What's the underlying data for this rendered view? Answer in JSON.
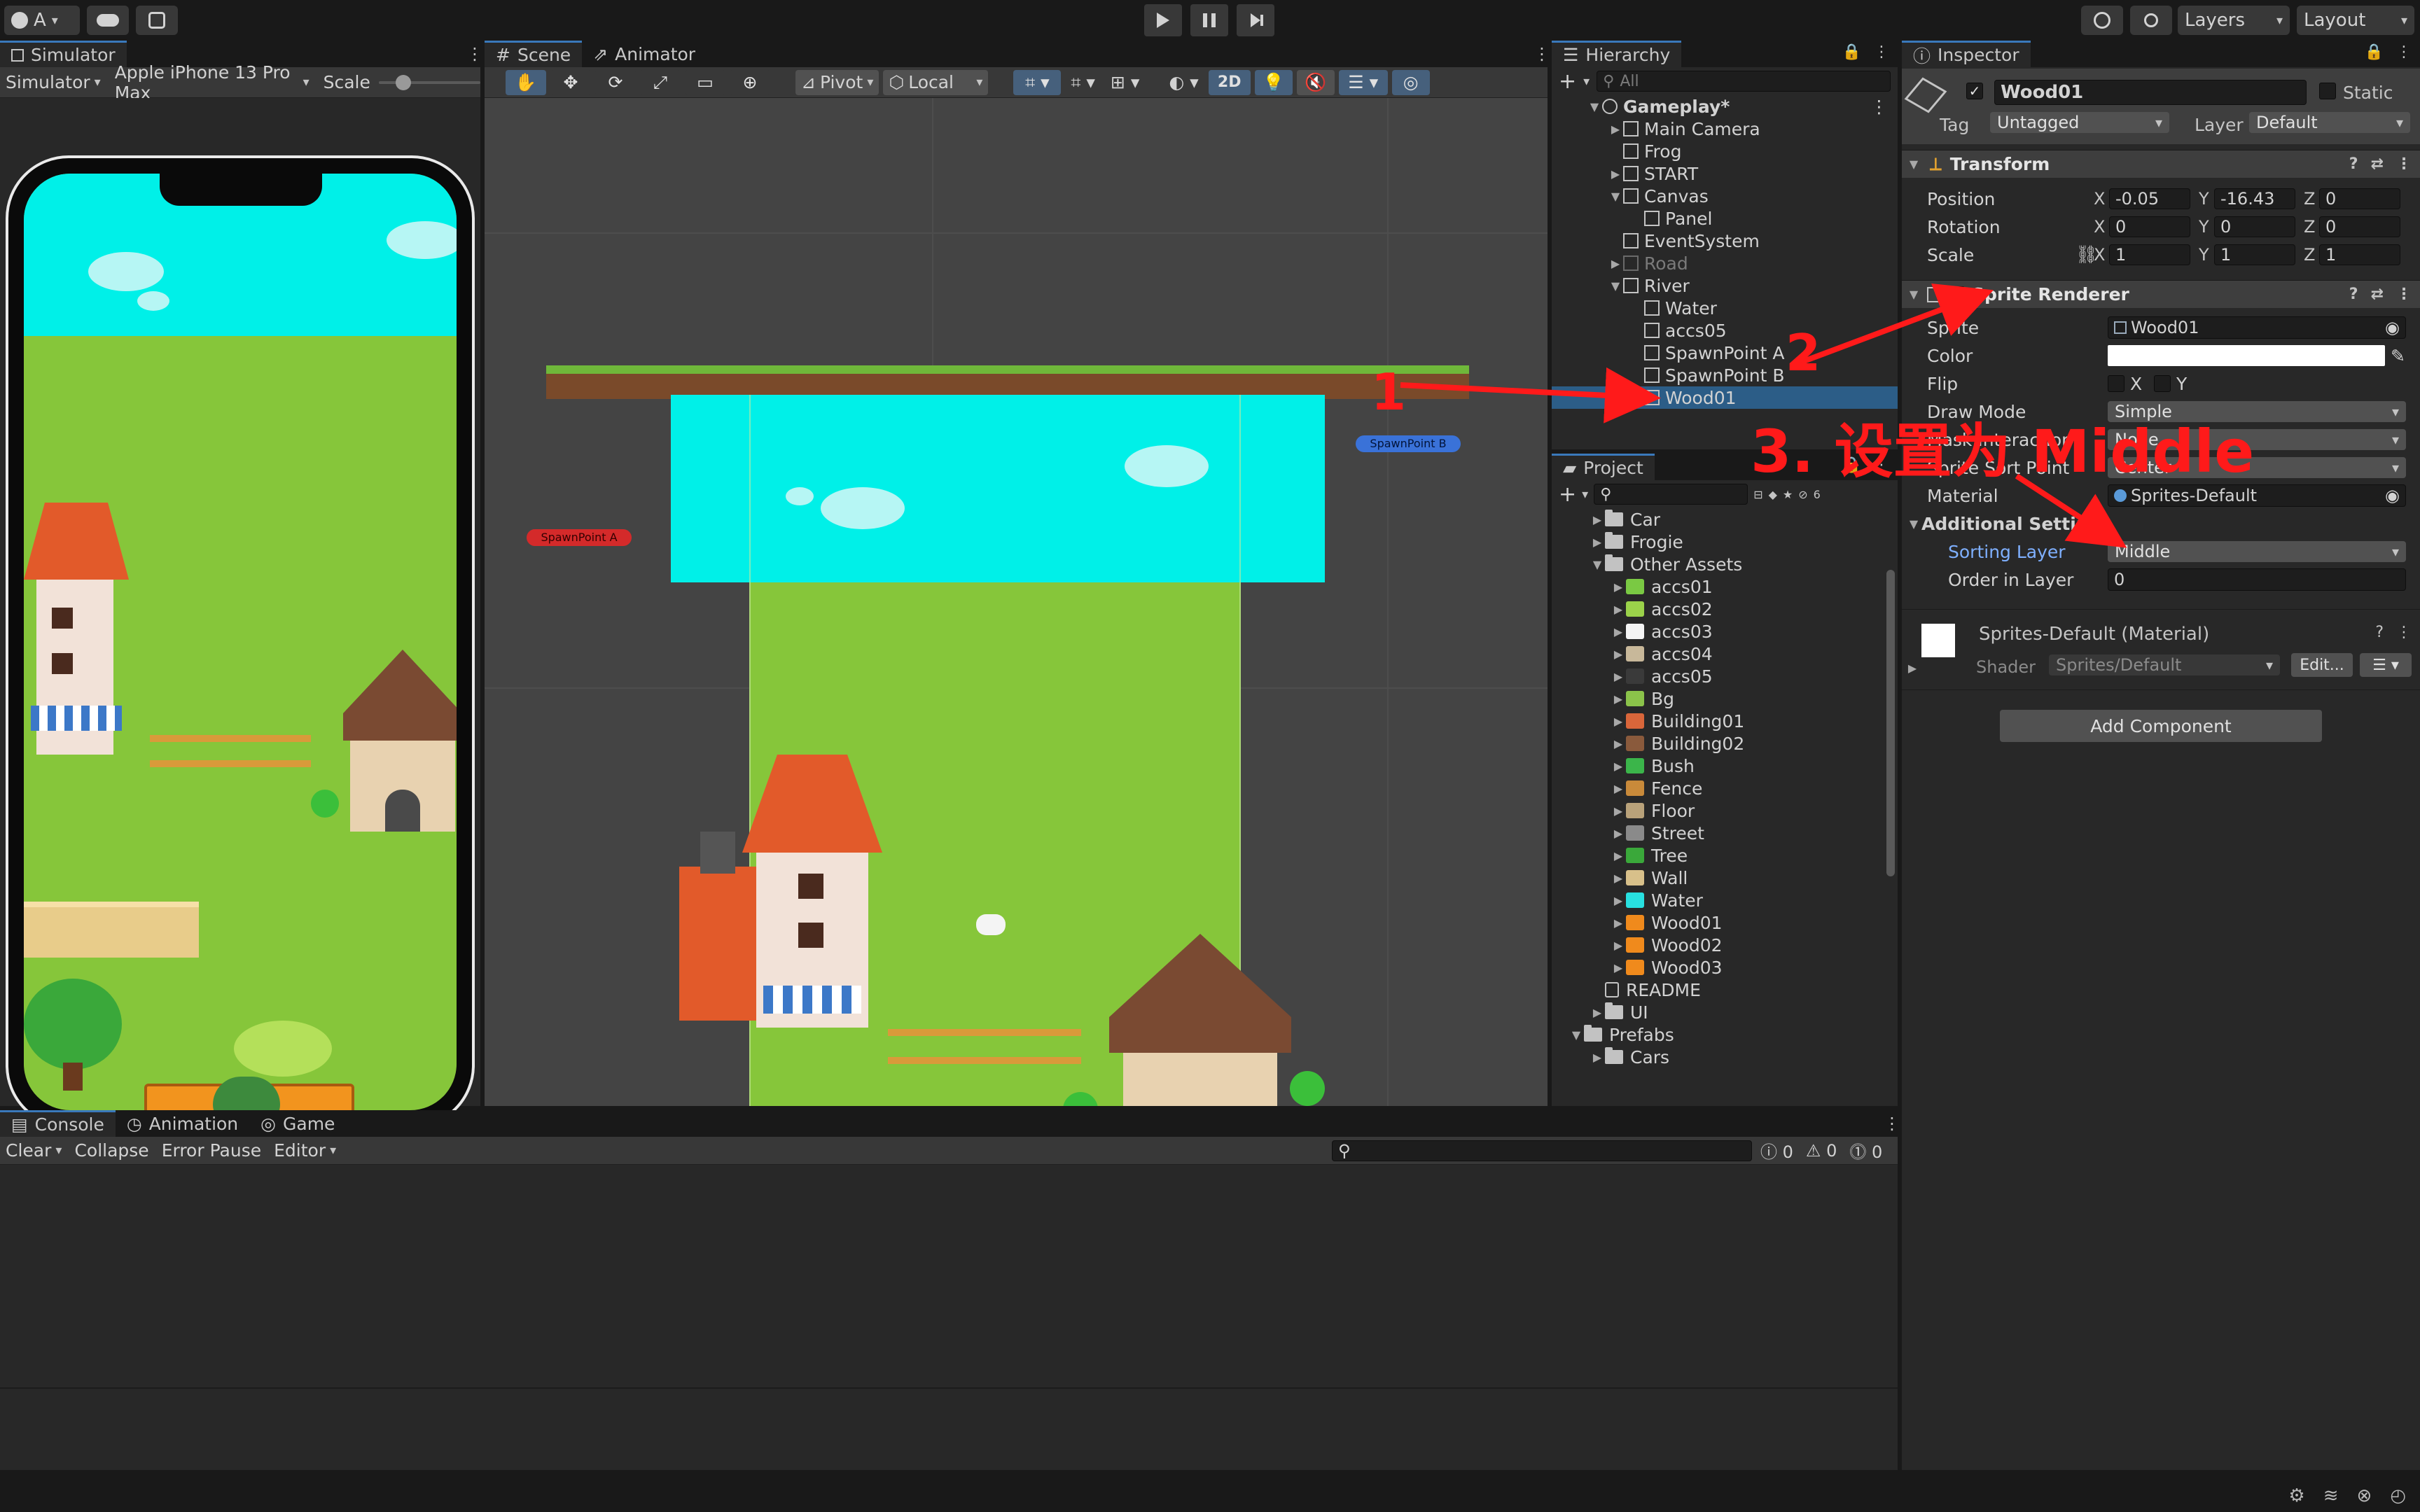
{
  "topbar": {
    "account": "A",
    "play_icon": "play-icon",
    "pause_icon": "pause-icon",
    "step_icon": "step-icon",
    "layers": "Layers",
    "layout": "Layout"
  },
  "simulator": {
    "tab": "Simulator",
    "mode": "Simulator",
    "device": "Apple iPhone 13 Pro Max",
    "scale_label": "Scale"
  },
  "scene": {
    "tabs": [
      "Scene",
      "Animator"
    ],
    "pivot": "Pivot",
    "local": "Local",
    "mode_2d": "2D",
    "spawn_a": "SpawnPoint A",
    "spawn_b": "SpawnPoint B"
  },
  "hierarchy": {
    "tab": "Hierarchy",
    "search_placeholder": "All",
    "items": [
      {
        "label": "Gameplay*",
        "depth": 0,
        "exp": "▼",
        "scene": true
      },
      {
        "label": "Main Camera",
        "depth": 1,
        "exp": "▶"
      },
      {
        "label": "Frog",
        "depth": 1,
        "exp": ""
      },
      {
        "label": "START",
        "depth": 1,
        "exp": "▶"
      },
      {
        "label": "Canvas",
        "depth": 1,
        "exp": "▼"
      },
      {
        "label": "Panel",
        "depth": 2,
        "exp": ""
      },
      {
        "label": "EventSystem",
        "depth": 1,
        "exp": ""
      },
      {
        "label": "Road",
        "depth": 1,
        "exp": "▶",
        "dim": true
      },
      {
        "label": "River",
        "depth": 1,
        "exp": "▼"
      },
      {
        "label": "Water",
        "depth": 2,
        "exp": ""
      },
      {
        "label": "accs05",
        "depth": 2,
        "exp": ""
      },
      {
        "label": "SpawnPoint A",
        "depth": 2,
        "exp": ""
      },
      {
        "label": "SpawnPoint B",
        "depth": 2,
        "exp": ""
      },
      {
        "label": "Wood01",
        "depth": 2,
        "exp": "",
        "selected": true
      }
    ]
  },
  "project": {
    "tab": "Project",
    "count": "6",
    "items": [
      {
        "label": "Car",
        "depth": 1,
        "kind": "folder",
        "exp": "▶"
      },
      {
        "label": "Frogie",
        "depth": 1,
        "kind": "folder",
        "exp": "▶"
      },
      {
        "label": "Other Assets",
        "depth": 1,
        "kind": "folder",
        "exp": "▼"
      },
      {
        "label": "accs01",
        "depth": 2,
        "kind": "asset",
        "color": "#7ac943"
      },
      {
        "label": "accs02",
        "depth": 2,
        "kind": "asset",
        "color": "#9bd24a"
      },
      {
        "label": "accs03",
        "depth": 2,
        "kind": "asset",
        "color": "#f4f4f4"
      },
      {
        "label": "accs04",
        "depth": 2,
        "kind": "asset",
        "color": "#c8b89a"
      },
      {
        "label": "accs05",
        "depth": 2,
        "kind": "asset",
        "color": "#3a3a3a"
      },
      {
        "label": "Bg",
        "depth": 2,
        "kind": "asset",
        "color": "#8bc34a"
      },
      {
        "label": "Building01",
        "depth": 2,
        "kind": "asset",
        "color": "#d9663a"
      },
      {
        "label": "Building02",
        "depth": 2,
        "kind": "asset",
        "color": "#8a5a3c"
      },
      {
        "label": "Bush",
        "depth": 2,
        "kind": "asset",
        "color": "#3bb54a"
      },
      {
        "label": "Fence",
        "depth": 2,
        "kind": "asset",
        "color": "#c98a3a"
      },
      {
        "label": "Floor",
        "depth": 2,
        "kind": "asset",
        "color": "#b9a27a"
      },
      {
        "label": "Street",
        "depth": 2,
        "kind": "asset",
        "color": "#8a8a8a"
      },
      {
        "label": "Tree",
        "depth": 2,
        "kind": "asset",
        "color": "#3aa83a"
      },
      {
        "label": "Wall",
        "depth": 2,
        "kind": "asset",
        "color": "#d8c08a"
      },
      {
        "label": "Water",
        "depth": 2,
        "kind": "asset",
        "color": "#28e0e0"
      },
      {
        "label": "Wood01",
        "depth": 2,
        "kind": "asset",
        "color": "#f08a1c"
      },
      {
        "label": "Wood02",
        "depth": 2,
        "kind": "asset",
        "color": "#f08a1c"
      },
      {
        "label": "Wood03",
        "depth": 2,
        "kind": "asset",
        "color": "#f08a1c"
      },
      {
        "label": "README",
        "depth": 1,
        "kind": "doc"
      },
      {
        "label": "UI",
        "depth": 1,
        "kind": "folder",
        "exp": "▶"
      },
      {
        "label": "Prefabs",
        "depth": 0,
        "kind": "folder",
        "exp": "▼"
      },
      {
        "label": "Cars",
        "depth": 1,
        "kind": "folder",
        "exp": "▶"
      }
    ]
  },
  "inspector": {
    "tab": "Inspector",
    "name": "Wood01",
    "static_label": "Static",
    "tag_label": "Tag",
    "tag": "Untagged",
    "layer_label": "Layer",
    "layer": "Default",
    "transform": {
      "title": "Transform",
      "position_label": "Position",
      "px": "-0.05",
      "py": "-16.43",
      "pz": "0",
      "rotation_label": "Rotation",
      "rx": "0",
      "ry": "0",
      "rz": "0",
      "scale_label": "Scale",
      "sx": "1",
      "sy": "1",
      "sz": "1"
    },
    "sprite_renderer": {
      "title": "Sprite Renderer",
      "sprite_label": "Sprite",
      "sprite": "Wood01",
      "color_label": "Color",
      "flip_label": "Flip",
      "flip_x": "X",
      "flip_y": "Y",
      "draw_mode_label": "Draw Mode",
      "draw_mode": "Simple",
      "mask_label": "Mask Interaction",
      "mask": "None",
      "sort_point_label": "Sprite Sort Point",
      "sort_point": "Center",
      "material_label": "Material",
      "material": "Sprites-Default",
      "additional": "Additional Settings",
      "sorting_layer_label": "Sorting Layer",
      "sorting_layer": "Middle",
      "order_label": "Order in Layer",
      "order": "0"
    },
    "material_block": {
      "title": "Sprites-Default (Material)",
      "shader_label": "Shader",
      "shader": "Sprites/Default",
      "edit": "Edit..."
    },
    "add_component": "Add Component"
  },
  "console": {
    "tabs": [
      "Console",
      "Animation",
      "Game"
    ],
    "clear": "Clear",
    "collapse": "Collapse",
    "error_pause": "Error Pause",
    "editor": "Editor",
    "info_count": "0",
    "warn_count": "0",
    "err_count": "0"
  },
  "annotations": {
    "a1": "1",
    "a2": "2",
    "a3": "3. 设置为 Middle"
  },
  "colors": {
    "accent": "#3a79bb",
    "selection": "#2c5d87",
    "annotation": "#ff1a1a",
    "water": "#00f0e8",
    "grass": "#86c63a"
  }
}
